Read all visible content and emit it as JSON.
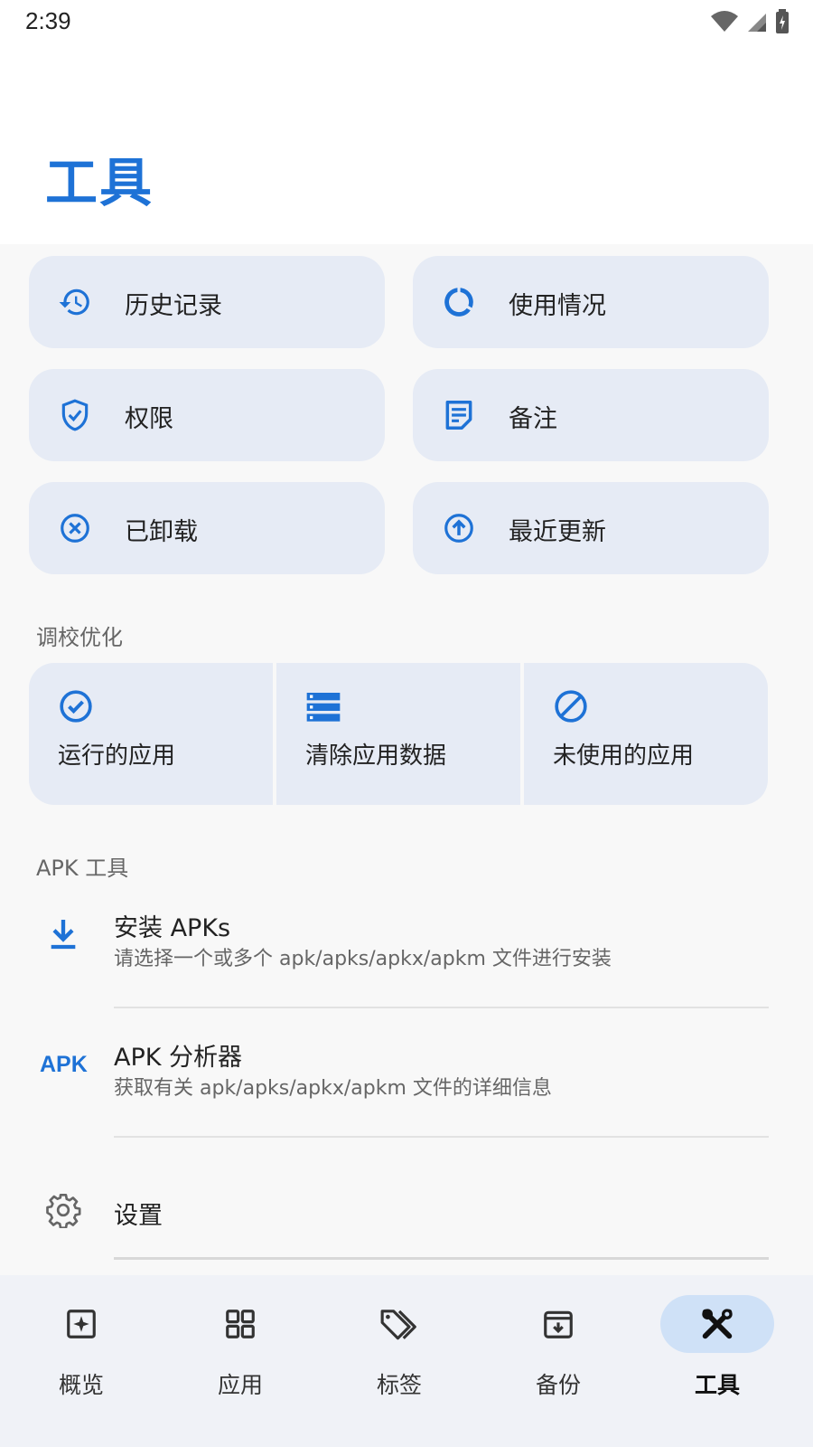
{
  "status_bar": {
    "time": "2:39"
  },
  "header": {
    "title": "工具"
  },
  "quick_actions": [
    {
      "label": "历史记录",
      "icon": "history-icon"
    },
    {
      "label": "使用情况",
      "icon": "data-usage-icon"
    },
    {
      "label": "权限",
      "icon": "shield-check-icon"
    },
    {
      "label": "备注",
      "icon": "note-icon"
    },
    {
      "label": "已卸载",
      "icon": "cancel-circle-icon"
    },
    {
      "label": "最近更新",
      "icon": "upload-circle-icon"
    }
  ],
  "optimize_section": {
    "title": "调校优化",
    "items": [
      {
        "label": "运行的应用",
        "icon": "check-circle-icon"
      },
      {
        "label": "清除应用数据",
        "icon": "storage-list-icon"
      },
      {
        "label": "未使用的应用",
        "icon": "block-icon"
      }
    ]
  },
  "apk_section": {
    "title": "APK 工具",
    "items": [
      {
        "title": "安装 APKs",
        "subtitle": "请选择一个或多个 apk/apks/apkx/apkm 文件进行安装",
        "icon": "download-icon"
      },
      {
        "title": "APK 分析器",
        "subtitle": "获取有关 apk/apks/apkx/apkm 文件的详细信息",
        "icon": "apk-text-icon",
        "icon_text": "APK"
      }
    ]
  },
  "settings": {
    "title": "设置",
    "icon": "gear-icon"
  },
  "bottom_nav": [
    {
      "label": "概览",
      "icon": "overview-icon",
      "active": false
    },
    {
      "label": "应用",
      "icon": "apps-grid-icon",
      "active": false
    },
    {
      "label": "标签",
      "icon": "tags-icon",
      "active": false
    },
    {
      "label": "备份",
      "icon": "archive-icon",
      "active": false
    },
    {
      "label": "工具",
      "icon": "tools-icon",
      "active": true
    }
  ],
  "colors": {
    "accent": "#1e72d6",
    "card": "#e6ebf5",
    "nav_active": "#cfe1f7"
  }
}
